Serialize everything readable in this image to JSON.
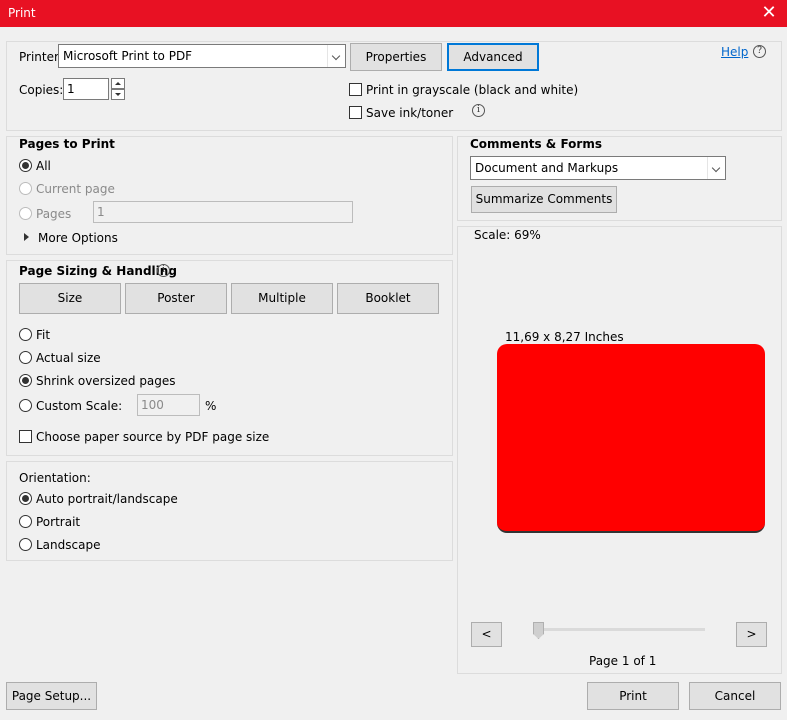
{
  "window": {
    "title": "Print",
    "accent": "#e81123"
  },
  "header": {
    "printer_label": "Printer:",
    "printer_value": "Microsoft Print to PDF",
    "properties_label": "Properties",
    "advanced_label": "Advanced",
    "help_label": "Help",
    "copies_label": "Copies:",
    "copies_value": "1",
    "grayscale_label": "Print in grayscale (black and white)",
    "save_ink_label": "Save ink/toner"
  },
  "pages_to_print": {
    "title": "Pages to Print",
    "all_label": "All",
    "current_label": "Current page",
    "pages_label": "Pages",
    "pages_value": "1",
    "more_options_label": "More Options"
  },
  "sizing": {
    "title": "Page Sizing & Handling",
    "tabs": [
      "Size",
      "Poster",
      "Multiple",
      "Booklet"
    ],
    "fit_label": "Fit",
    "actual_label": "Actual size",
    "shrink_label": "Shrink oversized pages",
    "custom_label": "Custom Scale:",
    "custom_value": "100",
    "percent_label": "%",
    "paper_source_label": "Choose paper source by PDF page size"
  },
  "orientation": {
    "title": "Orientation:",
    "auto_label": "Auto portrait/landscape",
    "portrait_label": "Portrait",
    "landscape_label": "Landscape"
  },
  "comments": {
    "title": "Comments & Forms",
    "select_value": "Document and Markups",
    "summarize_label": "Summarize Comments"
  },
  "preview": {
    "scale_text": "Scale:  69%",
    "page_size_text": "11,69 x 8,27 Inches",
    "page_color": "#ff0000",
    "prev_label": "<",
    "next_label": ">",
    "page_indicator": "Page 1 of 1"
  },
  "footer": {
    "page_setup_label": "Page Setup...",
    "print_label": "Print",
    "cancel_label": "Cancel"
  }
}
